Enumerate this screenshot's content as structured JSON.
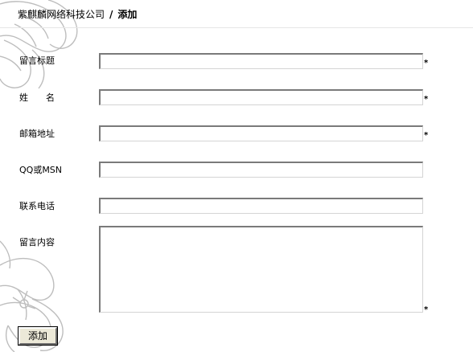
{
  "breadcrumb": {
    "company": "紫麒麟网络科技公司",
    "separator": "/",
    "current": "添加"
  },
  "form": {
    "fields": [
      {
        "label": "留言标题",
        "value": "",
        "required": true
      },
      {
        "label": "姓　　名",
        "value": "",
        "required": true
      },
      {
        "label": "邮箱地址",
        "value": "",
        "required": true
      },
      {
        "label": "QQ或MSN",
        "value": "",
        "required": false
      },
      {
        "label": "联系电话",
        "value": "",
        "required": false
      },
      {
        "label": "留言内容",
        "value": "",
        "required": true
      }
    ],
    "required_mark": "*",
    "submit_label": "添加"
  },
  "theme": {
    "background": "#ffffff",
    "decoration": "flower-line-art"
  }
}
